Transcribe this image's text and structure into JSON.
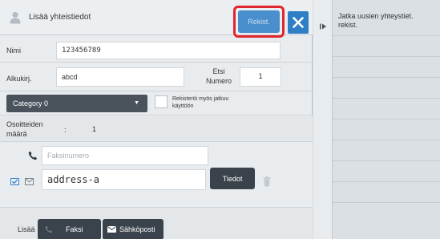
{
  "header": {
    "title": "Lisää yhteistiedot",
    "register_label": "Rekist.",
    "close_icon": "close-icon"
  },
  "form": {
    "name_label": "Nimi",
    "name_value": "123456789",
    "initial_label": "Alkukirj.",
    "initial_value": "abcd",
    "search_number_label": "Etsi Numero",
    "search_number_value": "1",
    "category_value": "Category 0",
    "also_register_label": "Rekisteröi myös jatkuv. käyttöön",
    "address_count_label": "Osoitteiden määrä",
    "address_count_separator": ":",
    "address_count_value": "1"
  },
  "address": {
    "fax_placeholder": "Faksinumero",
    "email_value": "address-a",
    "details_label": "Tiedot"
  },
  "bottom": {
    "add_label": "Lisää",
    "fax_label": "Faksi",
    "email_label": "Sähköposti"
  },
  "side": {
    "continue_label": "Jatka uusien yhteystiet. rekist."
  },
  "colors": {
    "accent_blue": "#2f7fc6",
    "highlight_red": "#e0262f",
    "dark_button": "#3a434c"
  }
}
